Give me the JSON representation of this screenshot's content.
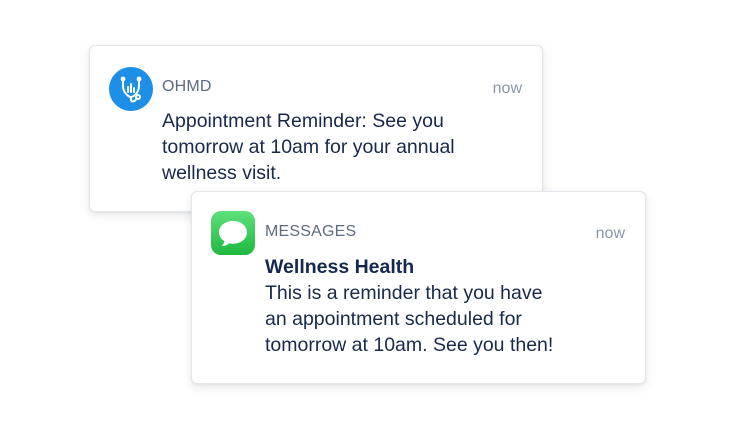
{
  "notifications": {
    "ohmd": {
      "app_name": "OHMD",
      "icon": "stethoscope-icon",
      "icon_color": "#1e8fe6",
      "time": "now",
      "body_lines": [
        "Appointment Reminder: See you",
        "tomorrow at 10am for your annual",
        "wellness visit."
      ]
    },
    "messages": {
      "app_name": "MESSAGES",
      "icon": "message-bubble-icon",
      "icon_color": "#34c759",
      "time": "now",
      "sender": "Wellness Health",
      "body_lines": [
        "This is a reminder that you have",
        "an appointment scheduled for",
        "tomorrow at 10am. See you then!"
      ]
    }
  }
}
